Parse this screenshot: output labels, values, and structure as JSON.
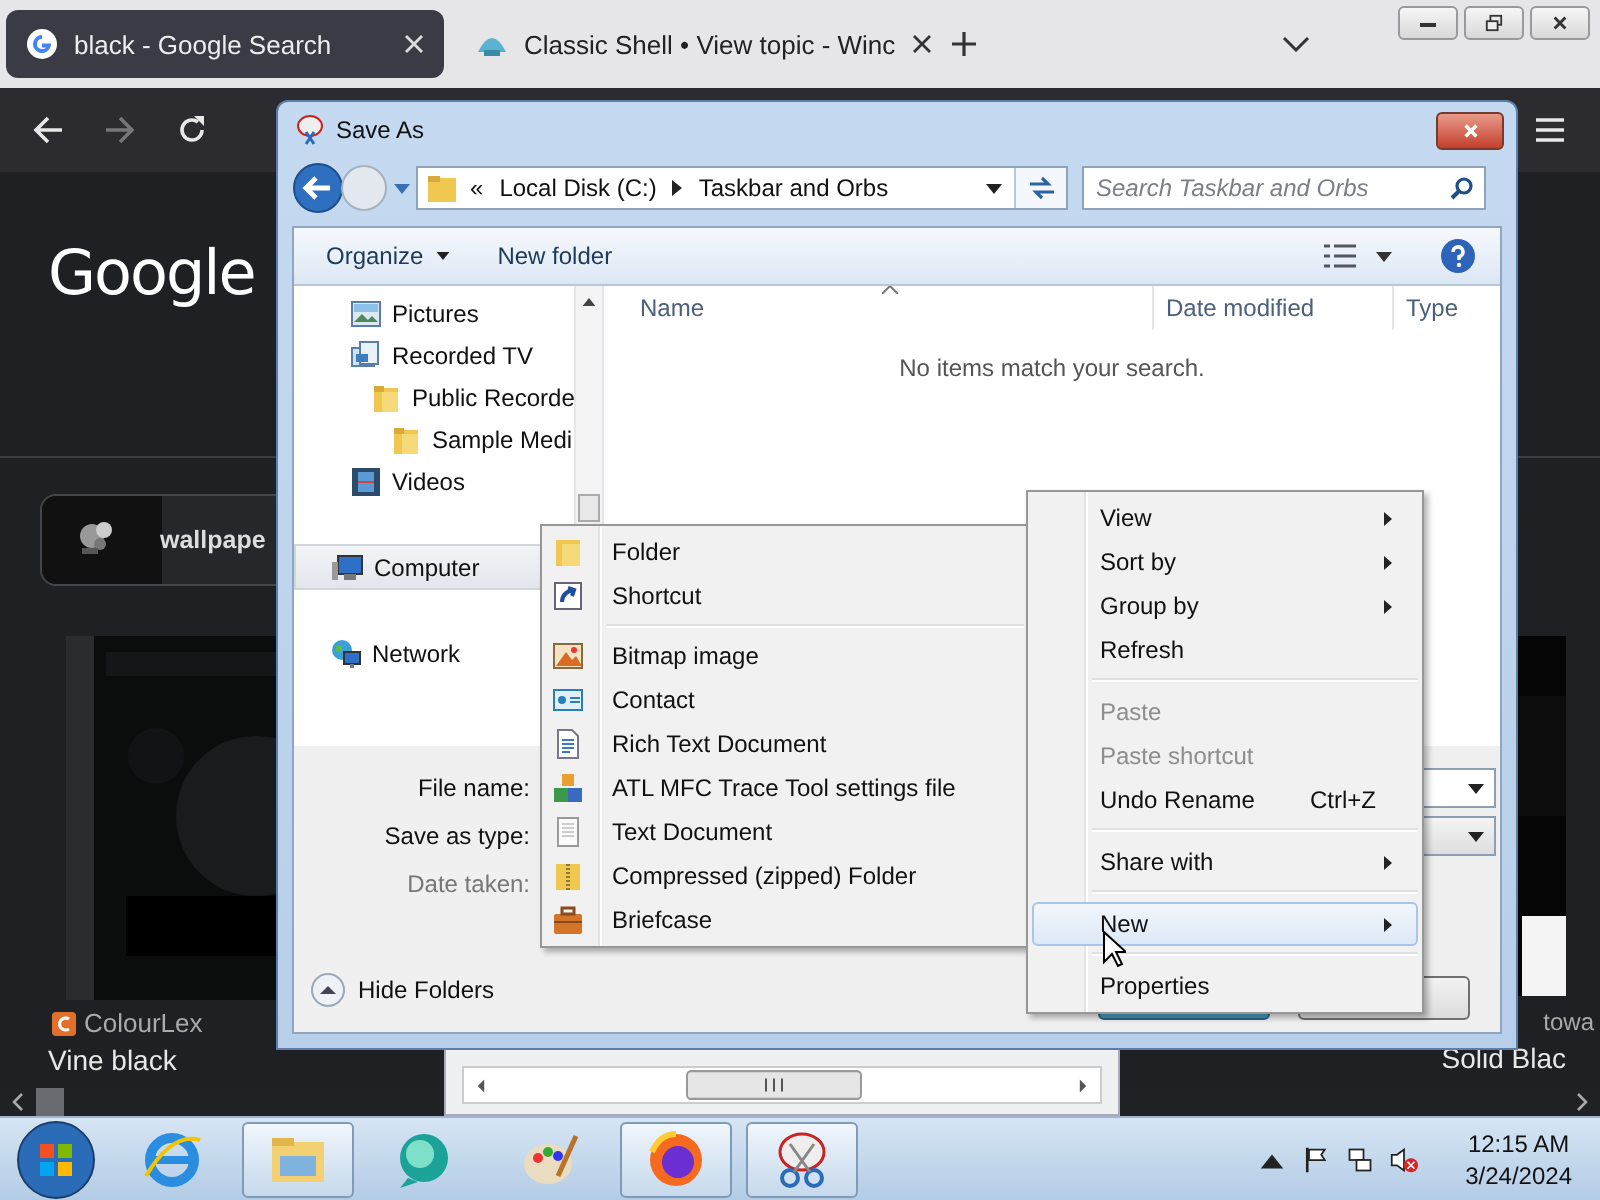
{
  "browser": {
    "tabs": [
      {
        "title": "black - Google Search",
        "selected": true
      },
      {
        "title": "Classic Shell • View topic - Winc",
        "selected": false
      }
    ],
    "page": {
      "logo": "Google",
      "card_label": "wallpape",
      "left_result": {
        "source": "ColourLex",
        "title": "Vine black"
      },
      "right_result": {
        "source": "towa",
        "title": "Solid Blac"
      }
    }
  },
  "dialog": {
    "title": "Save As",
    "address": {
      "overflow": "«",
      "segments": [
        "Local Disk (C:)",
        "Taskbar and Orbs"
      ]
    },
    "search": {
      "placeholder": "Search Taskbar and Orbs"
    },
    "toolbar": {
      "organize": "Organize",
      "new_folder": "New folder"
    },
    "nav": [
      {
        "label": "Pictures",
        "kind": "pictures",
        "selected": false
      },
      {
        "label": "Recorded TV",
        "kind": "tv",
        "selected": false,
        "children": [
          {
            "label": "Public Recorde",
            "kind": "folder",
            "selected": false,
            "children": [
              {
                "label": "Sample Medi",
                "kind": "folder",
                "selected": false
              }
            ]
          }
        ]
      },
      {
        "label": "Videos",
        "kind": "videos",
        "selected": false
      }
    ],
    "nav_groups": [
      {
        "label": "Computer",
        "kind": "computer",
        "selected": true
      },
      {
        "label": "Network",
        "kind": "network",
        "selected": false
      }
    ],
    "columns": [
      {
        "label": "Name",
        "sorted": true
      },
      {
        "label": "Date modified",
        "sorted": false
      },
      {
        "label": "Type",
        "sorted": false
      }
    ],
    "empty_message": "No items match your search.",
    "fields": [
      {
        "label": "File name:",
        "disabled": false
      },
      {
        "label": "Save as type:",
        "disabled": false
      },
      {
        "label": "Date taken:",
        "disabled": true
      }
    ],
    "hide_folders": "Hide Folders"
  },
  "context_menu": {
    "items": [
      {
        "kind": "item",
        "label": "View",
        "submenu": true,
        "disabled": false,
        "selected": false
      },
      {
        "kind": "item",
        "label": "Sort by",
        "submenu": true,
        "disabled": false,
        "selected": false
      },
      {
        "kind": "item",
        "label": "Group by",
        "submenu": true,
        "disabled": false,
        "selected": false
      },
      {
        "kind": "item",
        "label": "Refresh",
        "submenu": false,
        "disabled": false,
        "selected": false
      },
      {
        "kind": "separator"
      },
      {
        "kind": "item",
        "label": "Paste",
        "submenu": false,
        "disabled": true,
        "selected": false
      },
      {
        "kind": "item",
        "label": "Paste shortcut",
        "submenu": false,
        "disabled": true,
        "selected": false
      },
      {
        "kind": "item",
        "label": "Undo Rename",
        "shortcut": "Ctrl+Z",
        "submenu": false,
        "disabled": false,
        "selected": false
      },
      {
        "kind": "separator"
      },
      {
        "kind": "item",
        "label": "Share with",
        "submenu": true,
        "disabled": false,
        "selected": false
      },
      {
        "kind": "separator"
      },
      {
        "kind": "item",
        "label": "New",
        "submenu": true,
        "disabled": false,
        "selected": true
      },
      {
        "kind": "separator"
      },
      {
        "kind": "item",
        "label": "Properties",
        "submenu": false,
        "disabled": false,
        "selected": false
      }
    ]
  },
  "new_submenu": {
    "items": [
      {
        "kind": "folder",
        "label": "Folder"
      },
      {
        "kind": "shortcut",
        "label": "Shortcut"
      },
      {
        "kind": "separator"
      },
      {
        "kind": "bitmap",
        "label": "Bitmap image"
      },
      {
        "kind": "contact",
        "label": "Contact"
      },
      {
        "kind": "rtf",
        "label": "Rich Text Document"
      },
      {
        "kind": "trace",
        "label": "ATL MFC Trace Tool settings file"
      },
      {
        "kind": "text",
        "label": "Text Document"
      },
      {
        "kind": "zip",
        "label": "Compressed (zipped) Folder"
      },
      {
        "kind": "briefcase",
        "label": "Briefcase"
      }
    ]
  },
  "taskbar": {
    "apps": [
      {
        "kind": "ie",
        "active": false
      },
      {
        "kind": "explorer",
        "active": true
      },
      {
        "kind": "chat",
        "active": false
      },
      {
        "kind": "paint",
        "active": false
      },
      {
        "kind": "firefox",
        "active": true
      },
      {
        "kind": "snip",
        "active": true
      }
    ],
    "clock": {
      "time": "12:15 AM",
      "date": "3/24/2024"
    }
  }
}
